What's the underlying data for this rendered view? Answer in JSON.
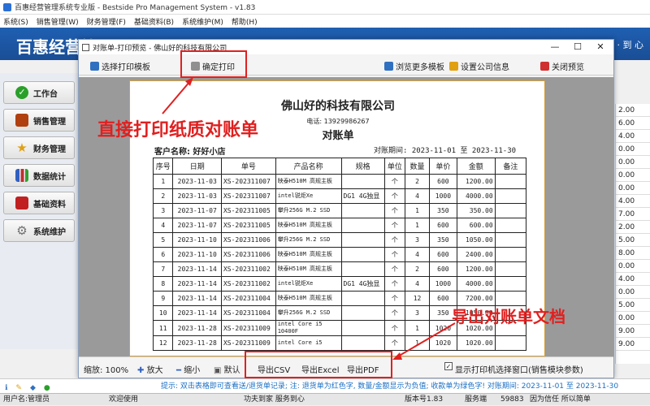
{
  "main_window": {
    "title": "百惠经营管理系统专业版 - Bestside Pro Management System - v1.83",
    "menu": [
      "系统(S)",
      "销售管理(W)",
      "财务管理(F)",
      "基础资料(B)",
      "系统维护(M)",
      "帮助(H)"
    ],
    "brand": "百惠经营管",
    "slogan": "· 到 心"
  },
  "sidebar": {
    "items": [
      {
        "label": "工作台",
        "icon": "check-icon",
        "color": "#2aa02a"
      },
      {
        "label": "销售管理",
        "icon": "book-icon",
        "color": "#b04010"
      },
      {
        "label": "财务管理",
        "icon": "star-icon",
        "color": "#e0a010"
      },
      {
        "label": "数据统计",
        "icon": "bar-chart-icon",
        "color": "#3060c0"
      },
      {
        "label": "基础资料",
        "icon": "folder-icon",
        "color": "#c02020"
      },
      {
        "label": "系统维护",
        "icon": "gear-icon",
        "color": "#707070"
      }
    ]
  },
  "right_grid": {
    "values": [
      "2.00",
      "6.00",
      "4.00",
      "0.00",
      "0.00",
      "0.00",
      "0.00",
      "4.00",
      "7.00",
      "2.00",
      "5.00",
      "8.00",
      "0.00",
      "4.00",
      "0.00",
      "5.00",
      "0.00",
      "9.00",
      "9.00"
    ]
  },
  "dialog": {
    "title": "对账单-打印预览 - 佛山好的科技有限公司",
    "toolbar": {
      "select_template": "选择打印模板",
      "confirm_print": "确定打印",
      "browse_templates": "浏览更多模板",
      "company_settings": "设置公司信息",
      "close_preview": "关闭预览"
    },
    "bottom": {
      "zoom_label": "缩放: 100%",
      "zoom_in": "放大",
      "zoom_out": "缩小",
      "default": "默认",
      "export_csv": "导出CSV",
      "export_excel": "导出Excel",
      "export_pdf": "导出PDF",
      "show_printer_dialog": "显示打印机选择窗口(销售模块参数)"
    }
  },
  "statement": {
    "company": "佛山好的科技有限公司",
    "phone": "电话: 13929986267",
    "title": "对账单",
    "customer": "客户名称: 好好小店",
    "period": "对账期间: 2023-11-01 至 2023-11-30",
    "headers": [
      "序号",
      "日期",
      "单号",
      "产品名称",
      "规格",
      "单位",
      "数量",
      "单价",
      "金额",
      "备注"
    ],
    "rows": [
      [
        "1",
        "2023-11-03",
        "XS-202311007",
        "映泰H510M 高规主板",
        "",
        "个",
        "2",
        "600",
        "1200.00",
        ""
      ],
      [
        "2",
        "2023-11-03",
        "XS-202311007",
        "intel锐炬Xe",
        "DG1 4G独显",
        "个",
        "4",
        "1000",
        "4000.00",
        ""
      ],
      [
        "3",
        "2023-11-07",
        "XS-202311005",
        "攀升256G M.2 SSD",
        "",
        "个",
        "1",
        "350",
        "350.00",
        ""
      ],
      [
        "4",
        "2023-11-07",
        "XS-202311005",
        "映泰H510M 高规主板",
        "",
        "个",
        "1",
        "600",
        "600.00",
        ""
      ],
      [
        "5",
        "2023-11-10",
        "XS-202311006",
        "攀升256G M.2 SSD",
        "",
        "个",
        "3",
        "350",
        "1050.00",
        ""
      ],
      [
        "6",
        "2023-11-10",
        "XS-202311006",
        "映泰H510M 高规主板",
        "",
        "个",
        "4",
        "600",
        "2400.00",
        ""
      ],
      [
        "7",
        "2023-11-14",
        "XS-202311002",
        "映泰H510M 高规主板",
        "",
        "个",
        "2",
        "600",
        "1200.00",
        ""
      ],
      [
        "8",
        "2023-11-14",
        "XS-202311002",
        "intel锐炬Xe",
        "DG1 4G独显",
        "个",
        "4",
        "1000",
        "4000.00",
        ""
      ],
      [
        "9",
        "2023-11-14",
        "XS-202311004",
        "映泰H510M 高规主板",
        "",
        "个",
        "12",
        "600",
        "7200.00",
        ""
      ],
      [
        "10",
        "2023-11-14",
        "XS-202311004",
        "攀升256G M.2 SSD",
        "",
        "个",
        "3",
        "350",
        "1050.00",
        ""
      ],
      [
        "11",
        "2023-11-28",
        "XS-202311009",
        "intel Core i5 10400F",
        "",
        "个",
        "1",
        "1020",
        "1020.00",
        ""
      ],
      [
        "12",
        "2023-11-28",
        "XS-202311009",
        "intel Core i5",
        "",
        "个",
        "1",
        "1020",
        "1020.00",
        ""
      ]
    ]
  },
  "annotations": {
    "print_note": "直接打印纸质对账单",
    "export_note": "导出对账单文档",
    "color": "#e02020"
  },
  "hint_bar": {
    "text": "提示: 双击表格即可查看送/退货单记录; 注: 退货单为红色字, 数量/金额显示为负值; 收款单为绿色字! 对账期间: 2023-11-01 至 2023-11-30"
  },
  "status_bar": {
    "user": "用户名:管理员",
    "welcome": "欢迎使用",
    "motto": "功夫到家 服务到心",
    "version": "版本号1.83",
    "service": "服务端",
    "port": "59883",
    "trust": "因为信任 所以简单"
  }
}
